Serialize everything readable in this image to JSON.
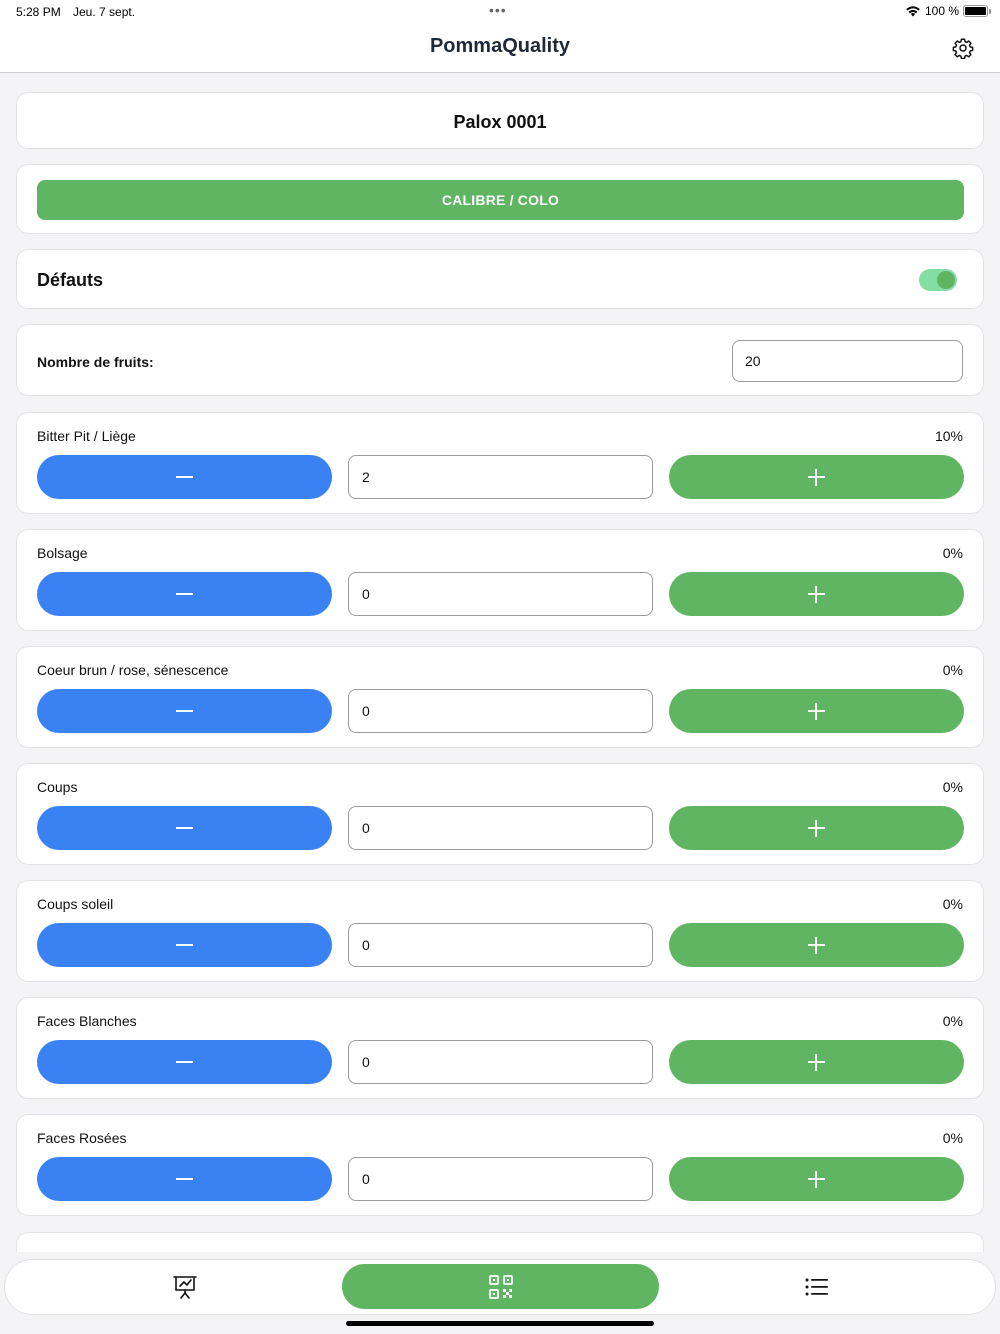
{
  "status": {
    "time": "5:28 PM",
    "date": "Jeu. 7 sept.",
    "battery": "100 %",
    "dots": "•••"
  },
  "nav": {
    "title": "PommaQuality",
    "settings_icon": "gear-icon"
  },
  "palox": {
    "label": "Palox 0001"
  },
  "calibre": {
    "label": "CALIBRE / COLO"
  },
  "defauts": {
    "label": "Défauts",
    "enabled": true
  },
  "fruits": {
    "label": "Nombre de fruits:",
    "value": "20"
  },
  "defects": [
    {
      "name": "Bitter Pit / Liège",
      "percent": "10%",
      "count": "2"
    },
    {
      "name": "Bolsage",
      "percent": "0%",
      "count": "0"
    },
    {
      "name": "Coeur brun / rose, sénescence",
      "percent": "0%",
      "count": "0"
    },
    {
      "name": "Coups",
      "percent": "0%",
      "count": "0"
    },
    {
      "name": "Coups soleil",
      "percent": "0%",
      "count": "0"
    },
    {
      "name": "Faces Blanches",
      "percent": "0%",
      "count": "0"
    },
    {
      "name": "Faces Rosées",
      "percent": "0%",
      "count": "0"
    }
  ],
  "tabs": [
    {
      "icon": "presentation-chart-icon"
    },
    {
      "icon": "qr-code-icon",
      "active": true
    },
    {
      "icon": "list-icon"
    }
  ],
  "colors": {
    "green": "#5fb562",
    "blue": "#3a82f4",
    "toggle_track": "#85dda6"
  }
}
